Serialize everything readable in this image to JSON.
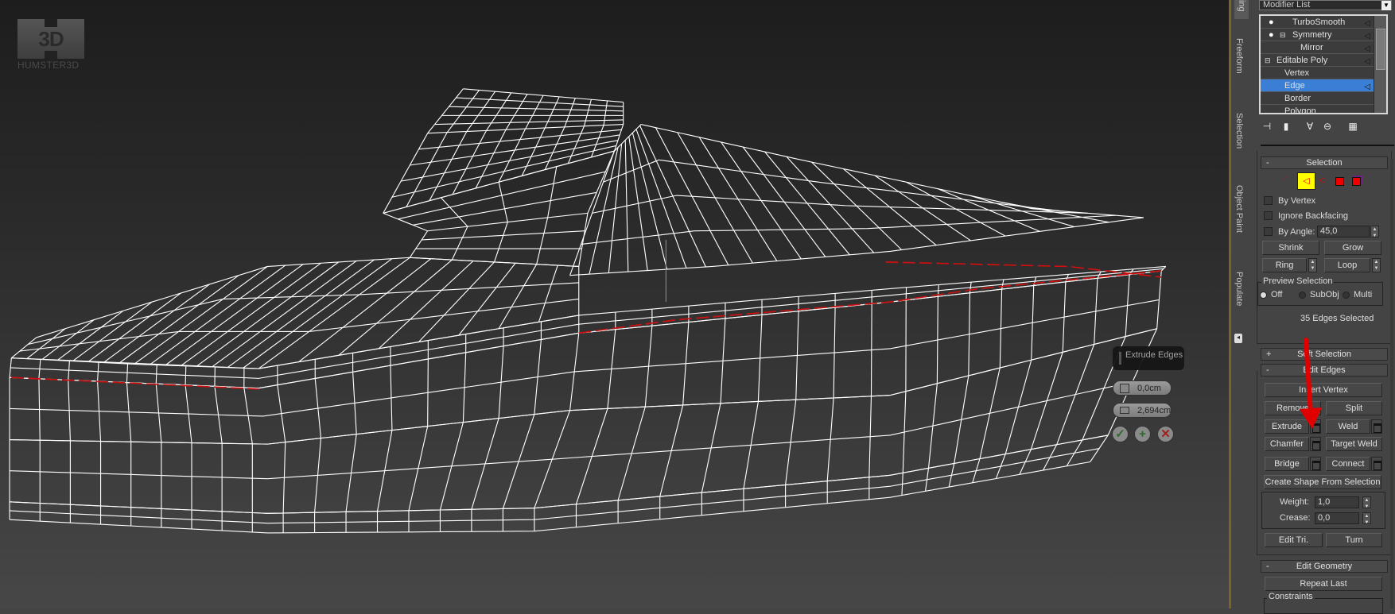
{
  "logo": {
    "mark": "3D",
    "text": "HUMSTER3D"
  },
  "viewport": {
    "caddy": {
      "title": "Extrude Edges",
      "height_value": "0,0cm",
      "width_value": "2,694cm",
      "ok": "✓",
      "apply": "+",
      "cancel": "✕"
    }
  },
  "tabs": [
    "ing",
    "Freeform",
    "Selection",
    "Object Paint",
    "Populate"
  ],
  "panel": {
    "modifier_list": "Modifier List",
    "stack": [
      {
        "label": "TurboSmooth",
        "icon": "bulb-icon"
      },
      {
        "label": "Symmetry",
        "icon": "bulb-icon"
      },
      {
        "label": "Mirror"
      },
      {
        "label": "Editable Poly"
      },
      {
        "label": "Vertex"
      },
      {
        "label": "Edge",
        "selected": true
      },
      {
        "label": "Border"
      },
      {
        "label": "Polygon"
      }
    ],
    "selection": {
      "title": "Selection",
      "collapse": "-",
      "by_vertex": "By Vertex",
      "ignore_backfacing": "Ignore Backfacing",
      "by_angle": "By Angle:",
      "angle_value": "45,0",
      "shrink": "Shrink",
      "grow": "Grow",
      "ring": "Ring",
      "loop": "Loop",
      "preview_title": "Preview Selection",
      "preview_options": [
        "Off",
        "SubObj",
        "Multi"
      ],
      "preview_selected": "Off",
      "status": "35 Edges Selected"
    },
    "soft_selection": {
      "title": "Soft Selection",
      "expand": "+"
    },
    "edit_edges": {
      "title": "Edit Edges",
      "collapse": "-",
      "insert_vertex": "Insert Vertex",
      "remove": "Remove",
      "split": "Split",
      "extrude": "Extrude",
      "weld": "Weld",
      "chamfer": "Chamfer",
      "target_weld": "Target Weld",
      "bridge": "Bridge",
      "connect": "Connect",
      "create_shape": "Create Shape From Selection",
      "weight_label": "Weight:",
      "weight_value": "1,0",
      "crease_label": "Crease:",
      "crease_value": "0,0",
      "edit_tri": "Edit Tri.",
      "turn": "Turn"
    },
    "edit_geometry": {
      "title": "Edit Geometry",
      "collapse": "-",
      "repeat_last": "Repeat Last",
      "constraints": "Constraints"
    }
  },
  "colors": {
    "selection_highlight": "#3a7fd5",
    "selected_edges": "#d01010",
    "annotation_arrow": "#e00000",
    "active_mode": "#ffff00"
  }
}
